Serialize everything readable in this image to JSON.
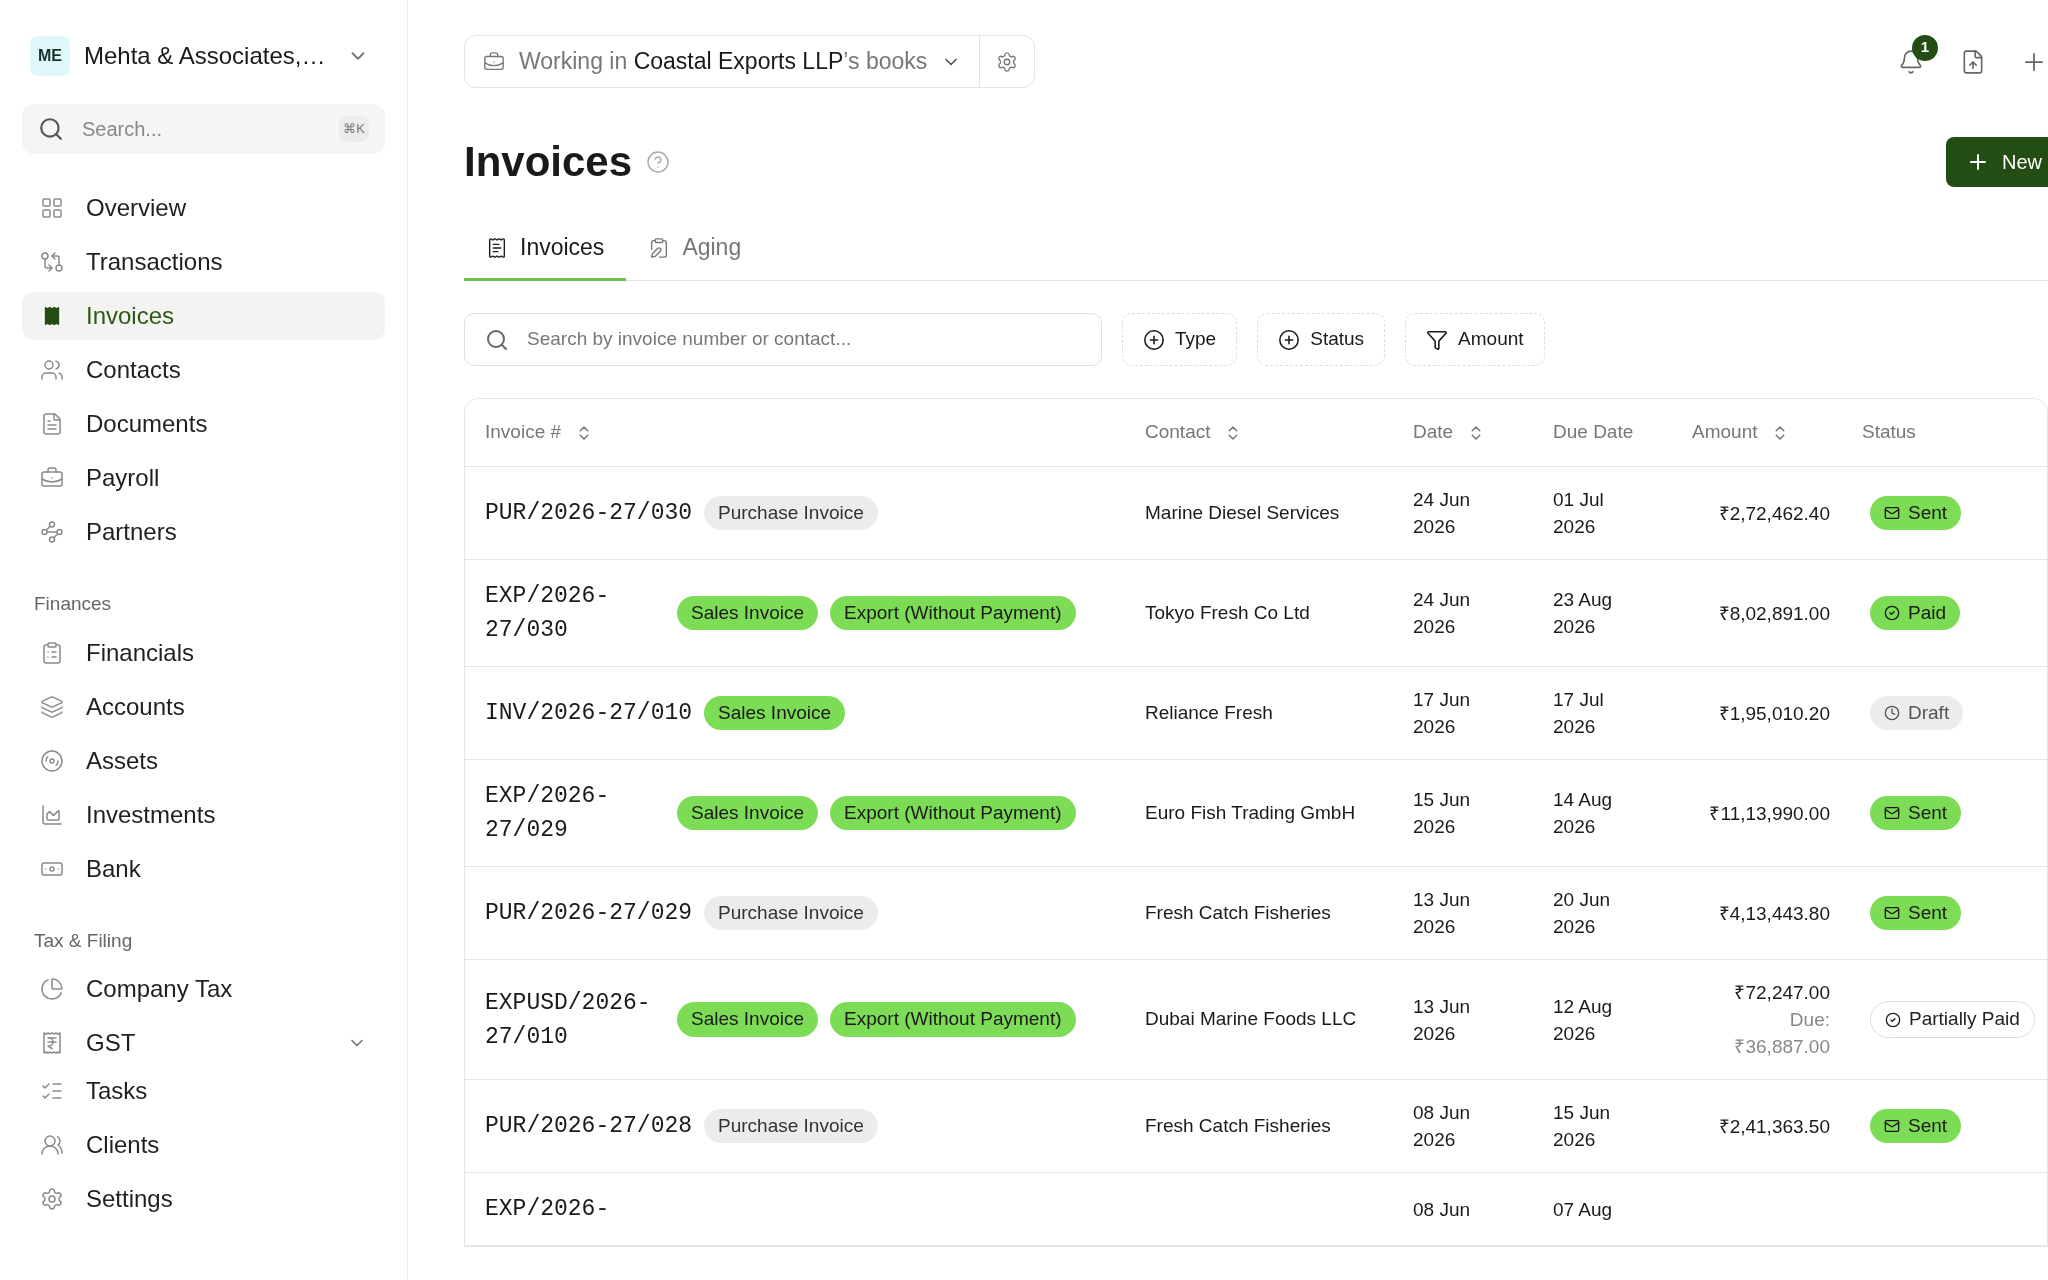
{
  "sidebar": {
    "org": {
      "initials": "ME",
      "name": "Mehta & Associates,…"
    },
    "search": {
      "placeholder": "Search...",
      "shortcut": "⌘K"
    },
    "groups": [
      {
        "items": [
          {
            "kind": "overview",
            "label": "Overview",
            "selected": false
          },
          {
            "kind": "transactions",
            "label": "Transactions",
            "selected": false
          },
          {
            "kind": "invoices",
            "label": "Invoices",
            "selected": true
          },
          {
            "kind": "contacts",
            "label": "Contacts",
            "selected": false
          },
          {
            "kind": "documents",
            "label": "Documents",
            "selected": false
          },
          {
            "kind": "payroll",
            "label": "Payroll",
            "selected": false
          },
          {
            "kind": "partners",
            "label": "Partners",
            "selected": false
          }
        ]
      },
      {
        "heading": "Finances",
        "items": [
          {
            "kind": "financials",
            "label": "Financials",
            "selected": false
          },
          {
            "kind": "accounts",
            "label": "Accounts",
            "selected": false
          },
          {
            "kind": "assets",
            "label": "Assets",
            "selected": false
          },
          {
            "kind": "investments",
            "label": "Investments",
            "selected": false
          },
          {
            "kind": "bank",
            "label": "Bank",
            "selected": false
          }
        ]
      },
      {
        "heading": "Tax & Filing",
        "items": [
          {
            "kind": "tax",
            "label": "Company Tax",
            "selected": false
          },
          {
            "kind": "gst",
            "label": "GST",
            "selected": false,
            "expanded": false
          }
        ]
      }
    ],
    "footer_items": [
      {
        "kind": "tasks",
        "label": "Tasks",
        "selected": false
      },
      {
        "kind": "clients",
        "label": "Clients",
        "selected": false
      },
      {
        "kind": "settings",
        "label": "Settings",
        "selected": false
      }
    ]
  },
  "header": {
    "workspace": {
      "prefix": "Working in ",
      "company": "Coastal Exports LLP",
      "suffix": "’s books"
    },
    "notification_count": "1"
  },
  "page": {
    "title": "Invoices",
    "new_button": "New"
  },
  "tabs": [
    {
      "label": "Invoices",
      "selected": true
    },
    {
      "label": "Aging",
      "selected": false
    }
  ],
  "search": {
    "placeholder": "Search by invoice number or contact..."
  },
  "filters": [
    {
      "kind": "add",
      "label": "Type"
    },
    {
      "kind": "add",
      "label": "Status"
    },
    {
      "kind": "filter",
      "label": "Amount"
    }
  ],
  "table": {
    "columns": [
      {
        "label": "Invoice #",
        "sortable": true
      },
      {
        "label": "Contact",
        "sortable": true
      },
      {
        "label": "Date",
        "sortable": true
      },
      {
        "label": "Due Date",
        "sortable": false
      },
      {
        "label": "Amount",
        "sortable": true
      },
      {
        "label": "Status",
        "sortable": false
      }
    ],
    "rows": [
      {
        "invoice": "PUR/2026-27/030",
        "tags": [
          {
            "kind": "purchase",
            "label": "Purchase Invoice"
          }
        ],
        "contact": "Marine Diesel Services",
        "date": "24 Jun 2026",
        "due_date": "01 Jul 2026",
        "amount": "₹2,72,462.40",
        "status": {
          "kind": "sent",
          "label": "Sent"
        }
      },
      {
        "invoice": "EXP/2026-27/030",
        "tags": [
          {
            "kind": "sales",
            "label": "Sales Invoice"
          },
          {
            "kind": "export",
            "label": "Export (Without Payment)"
          }
        ],
        "contact": "Tokyo Fresh Co Ltd",
        "date": "24 Jun 2026",
        "due_date": "23 Aug 2026",
        "amount": "₹8,02,891.00",
        "status": {
          "kind": "paid",
          "label": "Paid"
        }
      },
      {
        "invoice": "INV/2026-27/010",
        "tags": [
          {
            "kind": "sales",
            "label": "Sales Invoice"
          }
        ],
        "contact": "Reliance Fresh",
        "date": "17 Jun 2026",
        "due_date": "17 Jul 2026",
        "amount": "₹1,95,010.20",
        "status": {
          "kind": "draft",
          "label": "Draft"
        }
      },
      {
        "invoice": "EXP/2026-27/029",
        "tags": [
          {
            "kind": "sales",
            "label": "Sales Invoice"
          },
          {
            "kind": "export",
            "label": "Export (Without Payment)"
          }
        ],
        "contact": "Euro Fish Trading GmbH",
        "date": "15 Jun 2026",
        "due_date": "14 Aug 2026",
        "amount": "₹11,13,990.00",
        "status": {
          "kind": "sent",
          "label": "Sent"
        }
      },
      {
        "invoice": "PUR/2026-27/029",
        "tags": [
          {
            "kind": "purchase",
            "label": "Purchase Invoice"
          }
        ],
        "contact": "Fresh Catch Fisheries",
        "date": "13 Jun 2026",
        "due_date": "20 Jun 2026",
        "amount": "₹4,13,443.80",
        "status": {
          "kind": "sent",
          "label": "Sent"
        }
      },
      {
        "invoice": "EXPUSD/2026-27/010",
        "tags": [
          {
            "kind": "sales",
            "label": "Sales Invoice"
          },
          {
            "kind": "export",
            "label": "Export (Without Payment)"
          }
        ],
        "contact": "Dubai Marine Foods LLC",
        "date": "13 Jun 2026",
        "due_date": "12 Aug 2026",
        "amount": "₹72,247.00",
        "due": "Due: ₹36,887.00",
        "status": {
          "kind": "partial",
          "label": "Partially Paid"
        }
      },
      {
        "invoice": "PUR/2026-27/028",
        "tags": [
          {
            "kind": "purchase",
            "label": "Purchase Invoice"
          }
        ],
        "contact": "Fresh Catch Fisheries",
        "date": "08 Jun 2026",
        "due_date": "15 Jun 2026",
        "amount": "₹2,41,363.50",
        "status": {
          "kind": "sent",
          "label": "Sent"
        }
      },
      {
        "invoice": "EXP/2026-",
        "date": "08 Jun",
        "due_date": "07 Aug"
      }
    ]
  }
}
